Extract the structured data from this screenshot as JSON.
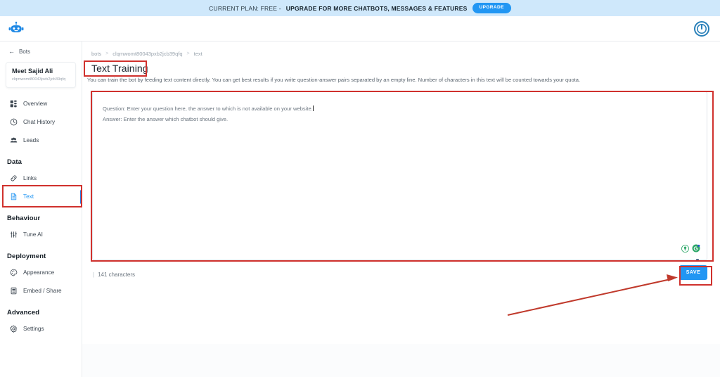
{
  "promo": {
    "plain_text": "CURRENT PLAN: FREE - ",
    "strong_text": "UPGRADE FOR MORE CHATBOTS, MESSAGES & FEATURES",
    "upgrade_label": "UPGRADE",
    "bg_color": "#cfe8fb",
    "button_color": "#2196f3"
  },
  "header": {
    "logo_name": "robot-logo",
    "power_icon_name": "power-icon"
  },
  "sidebar": {
    "back_label": "Bots",
    "bot": {
      "name": "Meet Sajid Ali",
      "id": "clqmwomt80043pxb2jcb39qfq"
    },
    "nav": [
      {
        "label": "Overview",
        "icon": "grid-icon",
        "active": false
      },
      {
        "label": "Chat History",
        "icon": "clock-icon",
        "active": false
      },
      {
        "label": "Leads",
        "icon": "people-icon",
        "active": false
      }
    ],
    "sections": [
      {
        "title": "Data",
        "items": [
          {
            "label": "Links",
            "icon": "link-icon",
            "active": false
          },
          {
            "label": "Text",
            "icon": "file-text-icon",
            "active": true
          }
        ]
      },
      {
        "title": "Behaviour",
        "items": [
          {
            "label": "Tune AI",
            "icon": "sliders-icon",
            "active": false
          }
        ]
      },
      {
        "title": "Deployment",
        "items": [
          {
            "label": "Appearance",
            "icon": "palette-icon",
            "active": false
          },
          {
            "label": "Embed / Share",
            "icon": "embed-icon",
            "active": false
          }
        ]
      },
      {
        "title": "Advanced",
        "items": [
          {
            "label": "Settings",
            "icon": "gear-icon",
            "active": false
          }
        ]
      }
    ]
  },
  "main": {
    "breadcrumb": [
      "bots",
      "clqmwomt80043pxb2jcb39qfq",
      "text"
    ],
    "breadcrumb_separator": ">",
    "title": "Text Training",
    "description": "You can train the bot by feeding text content directly. You can get best results if you write question-answer pairs separated by an empty line. Number of characters in this text will be counted towards your quota.",
    "textarea": {
      "line1": "Question: Enter your question here, the answer to which is not available on your website.",
      "line2": "Answer: Enter the answer which chatbot should give.",
      "placeholder": "Question: Enter your question here, the answer to which is not available on your website.\nAnswer: Enter the answer which chatbot should give."
    },
    "char_count": "141 characters",
    "char_count_prefix": "|",
    "save_label": "SAVE"
  },
  "annotations": {
    "color": "#d0312d",
    "boxes": [
      "page-title",
      "textarea",
      "sidebar-text-item",
      "save-button"
    ],
    "arrow": "points-to-save-button"
  }
}
